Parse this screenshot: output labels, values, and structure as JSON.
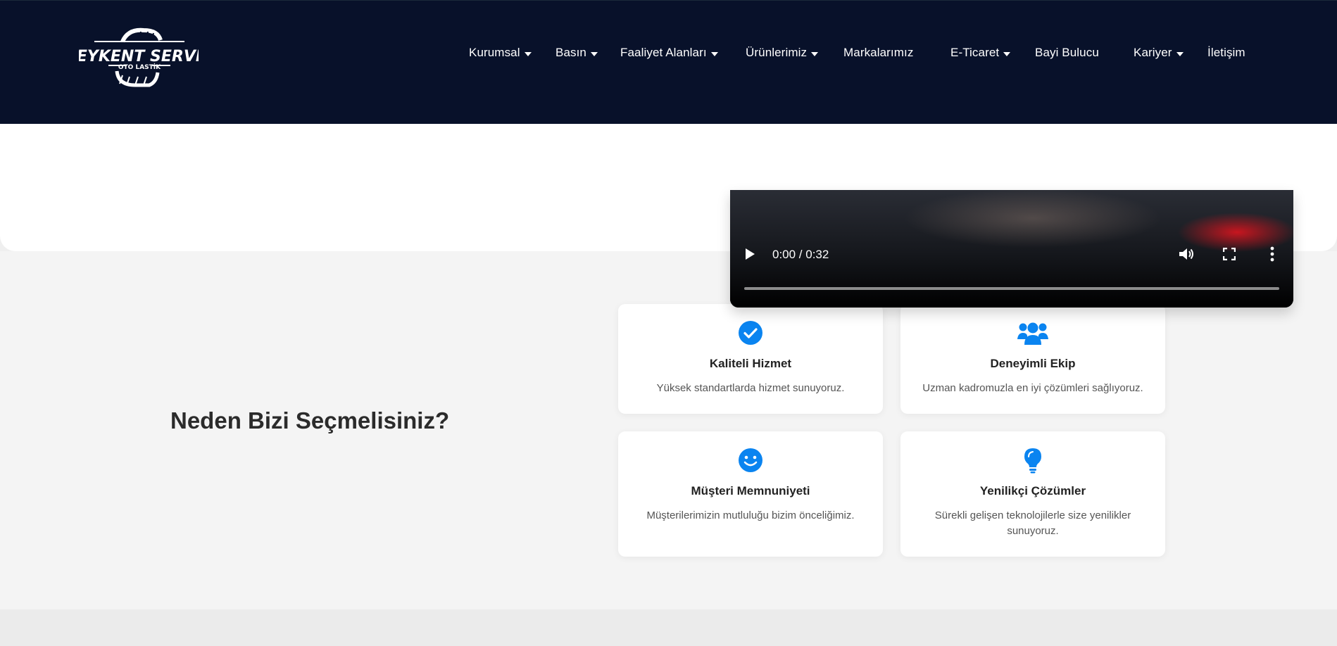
{
  "brand": {
    "name": "BEYKENT SERVİS",
    "tagline": "OTO LASTİK"
  },
  "nav": {
    "items": [
      {
        "label": "Kurumsal",
        "has_dropdown": true
      },
      {
        "label": "Basın",
        "has_dropdown": true
      },
      {
        "label": "Faaliyet Alanları",
        "has_dropdown": true
      },
      {
        "label": "Ürünlerimiz",
        "has_dropdown": true
      },
      {
        "label": "Markalarımız",
        "has_dropdown": false
      },
      {
        "label": "E-Ticaret",
        "has_dropdown": true
      },
      {
        "label": "Bayi Bulucu",
        "has_dropdown": false
      },
      {
        "label": "Kariyer",
        "has_dropdown": true
      },
      {
        "label": "İletişim",
        "has_dropdown": false
      }
    ]
  },
  "video": {
    "time": "0:00 / 0:32",
    "progress": 0
  },
  "why": {
    "title": "Neden Bizi Seçmelisiniz?",
    "cards": [
      {
        "icon": "check-circle-icon",
        "title": "Kaliteli Hizmet",
        "text": "Yüksek standartlarda hizmet sunuyoruz."
      },
      {
        "icon": "users-icon",
        "title": "Deneyimli Ekip",
        "text": "Uzman kadromuzla en iyi çözümleri sağlıyoruz."
      },
      {
        "icon": "smile-icon",
        "title": "Müşteri Memnuniyeti",
        "text": "Müşterilerimizin mutluluğu bizim önceliğimiz."
      },
      {
        "icon": "lightbulb-icon",
        "title": "Yenilikçi Çözümler",
        "text": "Sürekli gelişen teknolojilerle size yenilikler sunuyoruz."
      }
    ]
  },
  "colors": {
    "header_bg": "#08112a",
    "accent": "#0a84f0",
    "section_bg": "#f4f4f4"
  }
}
